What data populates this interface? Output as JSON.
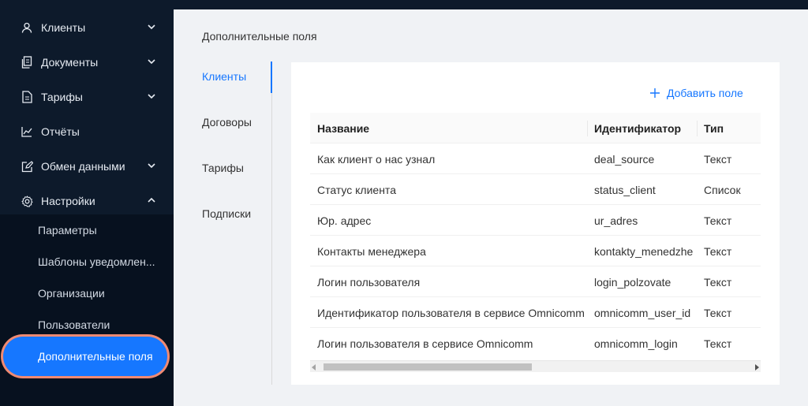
{
  "sidebar": {
    "items": [
      {
        "label": "Клиенты",
        "icon": "user-icon",
        "chevron": "down"
      },
      {
        "label": "Документы",
        "icon": "documents-icon",
        "chevron": "down"
      },
      {
        "label": "Тарифы",
        "icon": "tariff-icon",
        "chevron": "down"
      },
      {
        "label": "Отчёты",
        "icon": "chart-icon",
        "chevron": ""
      },
      {
        "label": "Обмен данными",
        "icon": "edit-icon",
        "chevron": "down"
      },
      {
        "label": "Настройки",
        "icon": "gear-icon",
        "chevron": "up"
      }
    ],
    "settings_submenu": [
      {
        "label": "Параметры"
      },
      {
        "label": "Шаблоны уведомлен..."
      },
      {
        "label": "Организации"
      },
      {
        "label": "Пользователи"
      },
      {
        "label": "Дополнительные поля",
        "active": true
      }
    ]
  },
  "main": {
    "title": "Дополнительные поля",
    "tabs": [
      {
        "label": "Клиенты",
        "active": true
      },
      {
        "label": "Договоры"
      },
      {
        "label": "Тарифы"
      },
      {
        "label": "Подписки"
      }
    ],
    "add_button_label": "Добавить поле",
    "table": {
      "columns": [
        "Название",
        "Идентификатор",
        "Тип"
      ],
      "rows": [
        [
          "Как клиент о нас узнал",
          "deal_source",
          "Текст"
        ],
        [
          "Статус клиента",
          "status_client",
          "Список"
        ],
        [
          "Юр. адрес",
          "ur_adres",
          "Текст"
        ],
        [
          "Контакты менеджера",
          "kontakty_menedzhe",
          "Текст"
        ],
        [
          "Логин пользователя",
          "login_polzovate",
          "Текст"
        ],
        [
          "Идентификатор пользователя в сервисе Omnicomm",
          "omnicomm_user_id",
          "Текст"
        ],
        [
          "Логин пользователя в сервисе Omnicomm",
          "omnicomm_login",
          "Текст"
        ]
      ]
    }
  },
  "colors": {
    "accent": "#1677ff",
    "sidebar_bg": "#0d1a2b",
    "highlight_ring": "#f08a72"
  }
}
